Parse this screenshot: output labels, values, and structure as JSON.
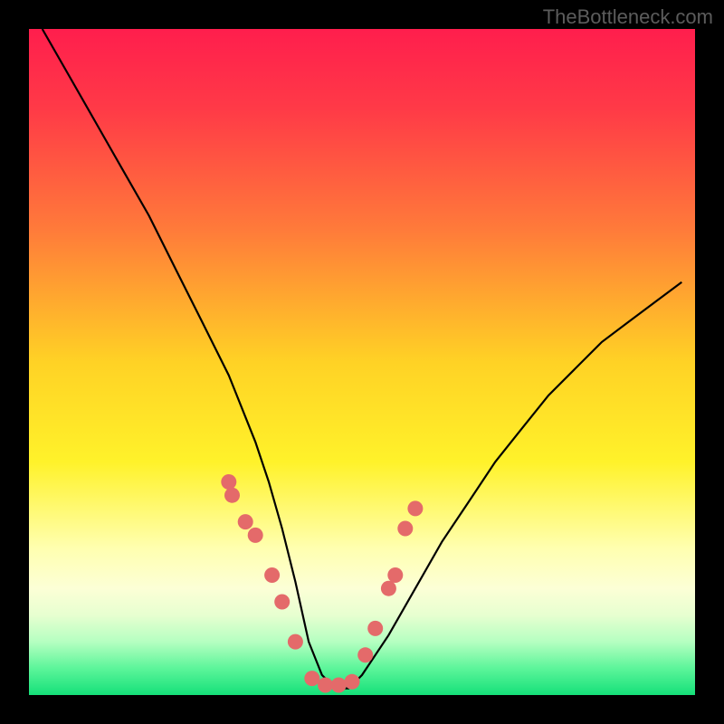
{
  "watermark": "TheBottleneck.com",
  "chart_data": {
    "type": "line",
    "title": "",
    "xlabel": "",
    "ylabel": "",
    "xlim": [
      0,
      100
    ],
    "ylim": [
      0,
      100
    ],
    "series": [
      {
        "name": "bottleneck-curve",
        "x": [
          2,
          6,
          10,
          14,
          18,
          22,
          26,
          30,
          34,
          36,
          38,
          40,
          42,
          44,
          46,
          48,
          50,
          54,
          58,
          62,
          66,
          70,
          74,
          78,
          82,
          86,
          90,
          94,
          98
        ],
        "y": [
          100,
          93,
          86,
          79,
          72,
          64,
          56,
          48,
          38,
          32,
          25,
          17,
          8,
          3,
          1,
          1,
          3,
          9,
          16,
          23,
          29,
          35,
          40,
          45,
          49,
          53,
          56,
          59,
          62
        ]
      }
    ],
    "markers": {
      "name": "data-points",
      "color": "#e46a6a",
      "x": [
        30,
        30.5,
        32.5,
        34,
        36.5,
        38,
        40,
        42.5,
        44.5,
        46.5,
        48.5,
        50.5,
        52,
        54,
        55,
        56.5,
        58
      ],
      "y": [
        32,
        30,
        26,
        24,
        18,
        14,
        8,
        2.5,
        1.5,
        1.5,
        2,
        6,
        10,
        16,
        18,
        25,
        28
      ]
    },
    "background_gradient": {
      "stops": [
        {
          "offset": 0.0,
          "color": "#ff1e4d"
        },
        {
          "offset": 0.12,
          "color": "#ff3a47"
        },
        {
          "offset": 0.3,
          "color": "#ff7a3a"
        },
        {
          "offset": 0.5,
          "color": "#ffd225"
        },
        {
          "offset": 0.65,
          "color": "#fff22a"
        },
        {
          "offset": 0.78,
          "color": "#ffffb0"
        },
        {
          "offset": 0.84,
          "color": "#fcffd6"
        },
        {
          "offset": 0.88,
          "color": "#e7ffd0"
        },
        {
          "offset": 0.92,
          "color": "#b5ffc1"
        },
        {
          "offset": 0.96,
          "color": "#5cf59a"
        },
        {
          "offset": 1.0,
          "color": "#15e079"
        }
      ]
    }
  }
}
